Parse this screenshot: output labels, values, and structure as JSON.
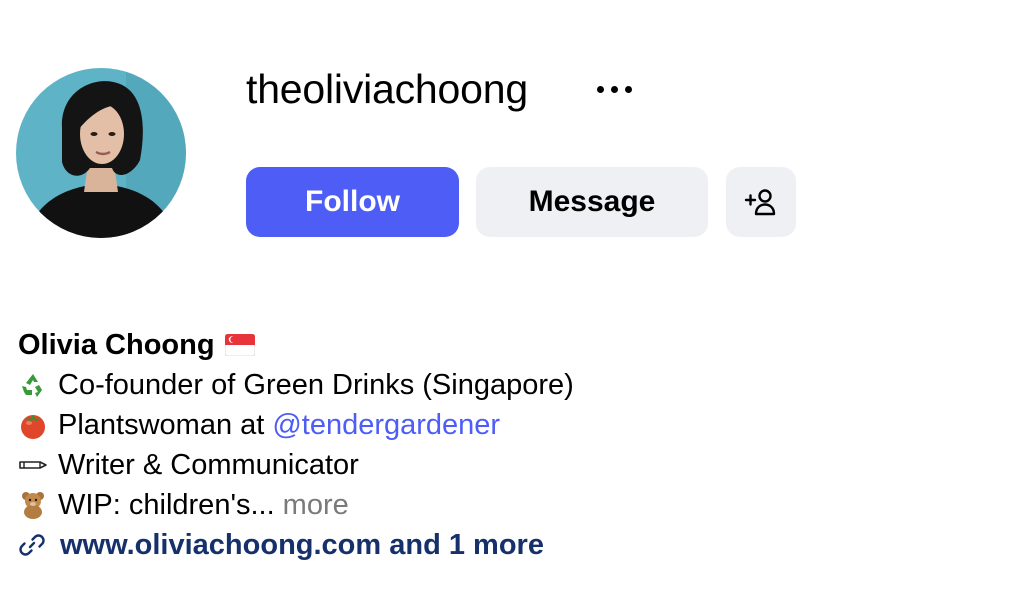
{
  "profile": {
    "username": "theoliviachoong",
    "more_options_icon": "more-horizontal-icon",
    "avatar_alt": "profile picture"
  },
  "actions": {
    "follow_label": "Follow",
    "message_label": "Message",
    "add_user_icon": "add-person-icon"
  },
  "bio": {
    "name": "Olivia Choong",
    "flag_icon": "singapore-flag-icon",
    "lines": [
      {
        "icon": "recycle-icon",
        "text": "Co-founder of Green Drinks (Singapore)"
      },
      {
        "icon": "tomato-icon",
        "text": "Plantswoman at",
        "mention": "@tendergardener"
      },
      {
        "icon": "pencil-icon",
        "text": "Writer & Communicator"
      },
      {
        "icon": "teddy-bear-icon",
        "text": "WIP: children's...",
        "more": "more"
      }
    ],
    "link_icon": "link-icon",
    "link_text": "www.oliviachoong.com and 1 more"
  },
  "colors": {
    "accent": "#4d5df5",
    "button_secondary": "#eff0f3",
    "link": "#15306b",
    "muted": "#7a7a7a",
    "avatar_bg": "#5fb3c6"
  }
}
